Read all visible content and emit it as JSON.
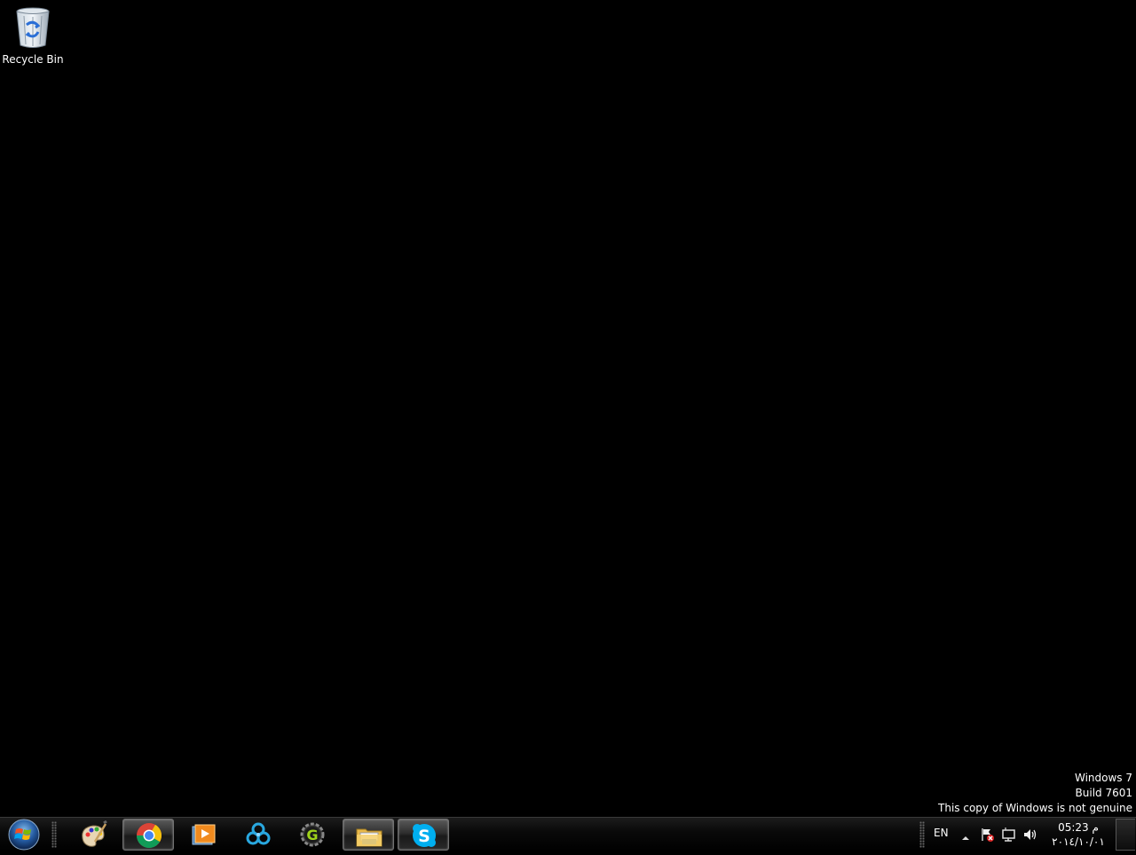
{
  "desktop": {
    "icons": [
      {
        "label": "Recycle Bin",
        "icon": "recycle-bin-icon"
      }
    ]
  },
  "watermark": {
    "line1": "Windows 7",
    "line2": "Build 7601",
    "line3": "This copy of Windows is not genuine"
  },
  "taskbar": {
    "start": {
      "icon": "windows-logo-icon"
    },
    "pinned": [
      {
        "icon": "paint-palette-icon",
        "active": false
      },
      {
        "icon": "chrome-icon",
        "active": true
      },
      {
        "icon": "media-player-icon",
        "active": false
      },
      {
        "icon": "network-hub-icon",
        "active": false
      },
      {
        "icon": "gear-g-icon",
        "active": false
      },
      {
        "icon": "file-explorer-icon",
        "active": true
      },
      {
        "icon": "skype-icon",
        "active": true
      }
    ],
    "tray": {
      "language": "EN",
      "clock_time": "05:23 م",
      "clock_date": "٢٠١٤/١٠/٠١"
    }
  },
  "colors": {
    "desktop_background": "#000000",
    "skype_blue": "#00aff0",
    "chrome_red": "#db4437",
    "chrome_yellow": "#f4c20d",
    "chrome_green": "#0f9d58"
  }
}
